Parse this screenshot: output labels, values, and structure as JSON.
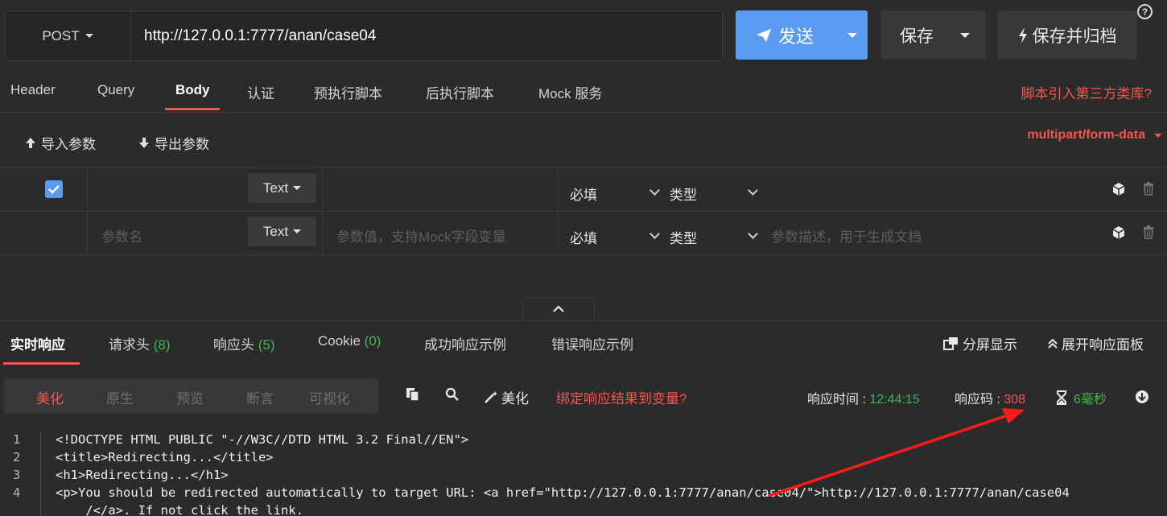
{
  "request": {
    "method": "POST",
    "url": "http://127.0.0.1:7777/anan/case04"
  },
  "actions": {
    "send_label": "发送",
    "save_label": "保存",
    "save_archive_label": "保存并归档",
    "help_glyph": "?"
  },
  "request_tabs": [
    "Header",
    "Query",
    "Body",
    "认证",
    "预执行脚本",
    "后执行脚本",
    "Mock 服务"
  ],
  "active_request_tab": "Body",
  "script_library_link": "脚本引入第三方类库?",
  "body_toolbar": {
    "import_label": "导入参数",
    "export_label": "导出参数",
    "content_type": "multipart/form-data"
  },
  "params": {
    "rows": [
      {
        "checked": true,
        "name": "",
        "type": "Text",
        "value": "",
        "required": "必填",
        "kind": "类型",
        "description": ""
      },
      {
        "checked": false,
        "name_placeholder": "参数名",
        "type": "Text",
        "value_placeholder": "参数值，支持Mock字段变量",
        "required": "必填",
        "kind": "类型",
        "description_placeholder": "参数描述，用于生成文档"
      }
    ]
  },
  "response_tabs": {
    "realtime": "实时响应",
    "req_headers": "请求头",
    "req_headers_count": "(8)",
    "resp_headers": "响应头",
    "resp_headers_count": "(5)",
    "cookie": "Cookie",
    "cookie_count": "(0)",
    "success_example": "成功响应示例",
    "error_example": "错误响应示例",
    "split_view": "分屏显示",
    "expand_panel": "展开响应面板"
  },
  "view_modes": [
    "美化",
    "原生",
    "预览",
    "断言",
    "可视化"
  ],
  "active_view_mode": "美化",
  "view_tools": {
    "beautify_label": "美化",
    "bind_link": "绑定响应结果到变量?"
  },
  "response_meta": {
    "time_label": "响应时间 : ",
    "time_value": "12:44:15",
    "code_label": "响应码 : ",
    "code_value": "308",
    "duration": "6毫秒"
  },
  "response_body": [
    {
      "n": "1",
      "text": "<!DOCTYPE HTML PUBLIC \"-//W3C//DTD HTML 3.2 Final//EN\">"
    },
    {
      "n": "2",
      "text": "<title>Redirecting...</title>"
    },
    {
      "n": "3",
      "text": "<h1>Redirecting...</h1>"
    },
    {
      "n": "4",
      "text": "<p>You should be redirected automatically to target URL: <a href=\"http://127.0.0.1:7777/anan/case04/\">http://127.0.0.1:7777/anan/case04"
    },
    {
      "n": "",
      "text": "    /</a>. If not click the link."
    }
  ],
  "colors": {
    "accent_blue": "#5b9cf2",
    "accent_red": "#f3564e",
    "success_green": "#3fb950",
    "background": "#2b2b2b"
  }
}
